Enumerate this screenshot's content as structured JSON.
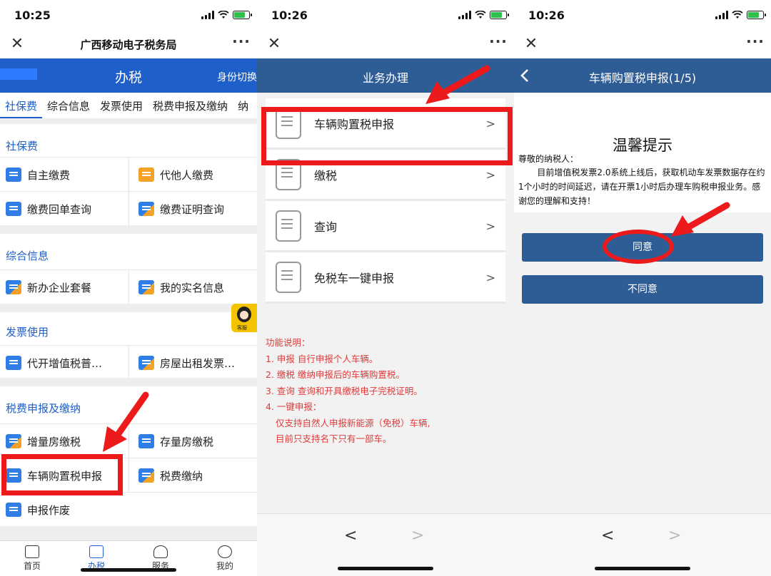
{
  "screens": [
    {
      "status_time": "10:25",
      "app_title": "广西移动电子税务局",
      "header_title": "办税",
      "header_switch": "身份切换",
      "tabs": [
        "社保费",
        "综合信息",
        "发票使用",
        "税费申报及缴纳",
        "纳"
      ],
      "sections": [
        {
          "title": "社保费",
          "items": [
            "自主缴费",
            "代他人缴费",
            "缴费回单查询",
            "缴费证明查询"
          ]
        },
        {
          "title": "综合信息",
          "items": [
            "新办企业套餐",
            "我的实名信息"
          ]
        },
        {
          "title": "发票使用",
          "items": [
            "代开增值税普…",
            "房屋出租发票…"
          ]
        },
        {
          "title": "税费申报及缴纳",
          "items": [
            "增量房缴税",
            "存量房缴税",
            "车辆购置税申报",
            "税费缴纳",
            "申报作废"
          ]
        }
      ],
      "avatar_label": "客服",
      "nav": [
        "首页",
        "办税",
        "服务",
        "我的"
      ]
    },
    {
      "status_time": "10:26",
      "bar_title": "业务办理",
      "services": [
        "车辆购置税申报",
        "缴税",
        "查询",
        "免税车一键申报"
      ],
      "chevron": ">",
      "notes": [
        "功能说明：",
        "1. 申报 自行申报个人车辆。",
        "2. 缴税 缴纳申报后的车辆购置税。",
        "3. 查询 查询和开具缴税电子完税证明。",
        "4. 一键申报：",
        "仅支持自然人申报新能源（免税）车辆,",
        "目前只支持名下只有一部车。"
      ],
      "browser_back": "<",
      "browser_forward": ">"
    },
    {
      "status_time": "10:26",
      "bar_title": "车辆购置税申报(1/5)",
      "notice_title": "温馨提示",
      "notice_greet": "尊敬的纳税人：",
      "notice_body": "目前增值税发票2.0系统上线后，获取机动车发票数据存在约1个小时的时间延迟，请在开票1小时后办理车购税申报业务。感谢您的理解和支持！",
      "agree": "同意",
      "disagree": "不同意",
      "browser_back": "<",
      "browser_forward": ">"
    }
  ],
  "colors": {
    "header_blue": "#1e5fc9",
    "bar_blue": "#2e5d96",
    "highlight_red": "#ec1a1a",
    "note_red": "#e03a3a"
  }
}
